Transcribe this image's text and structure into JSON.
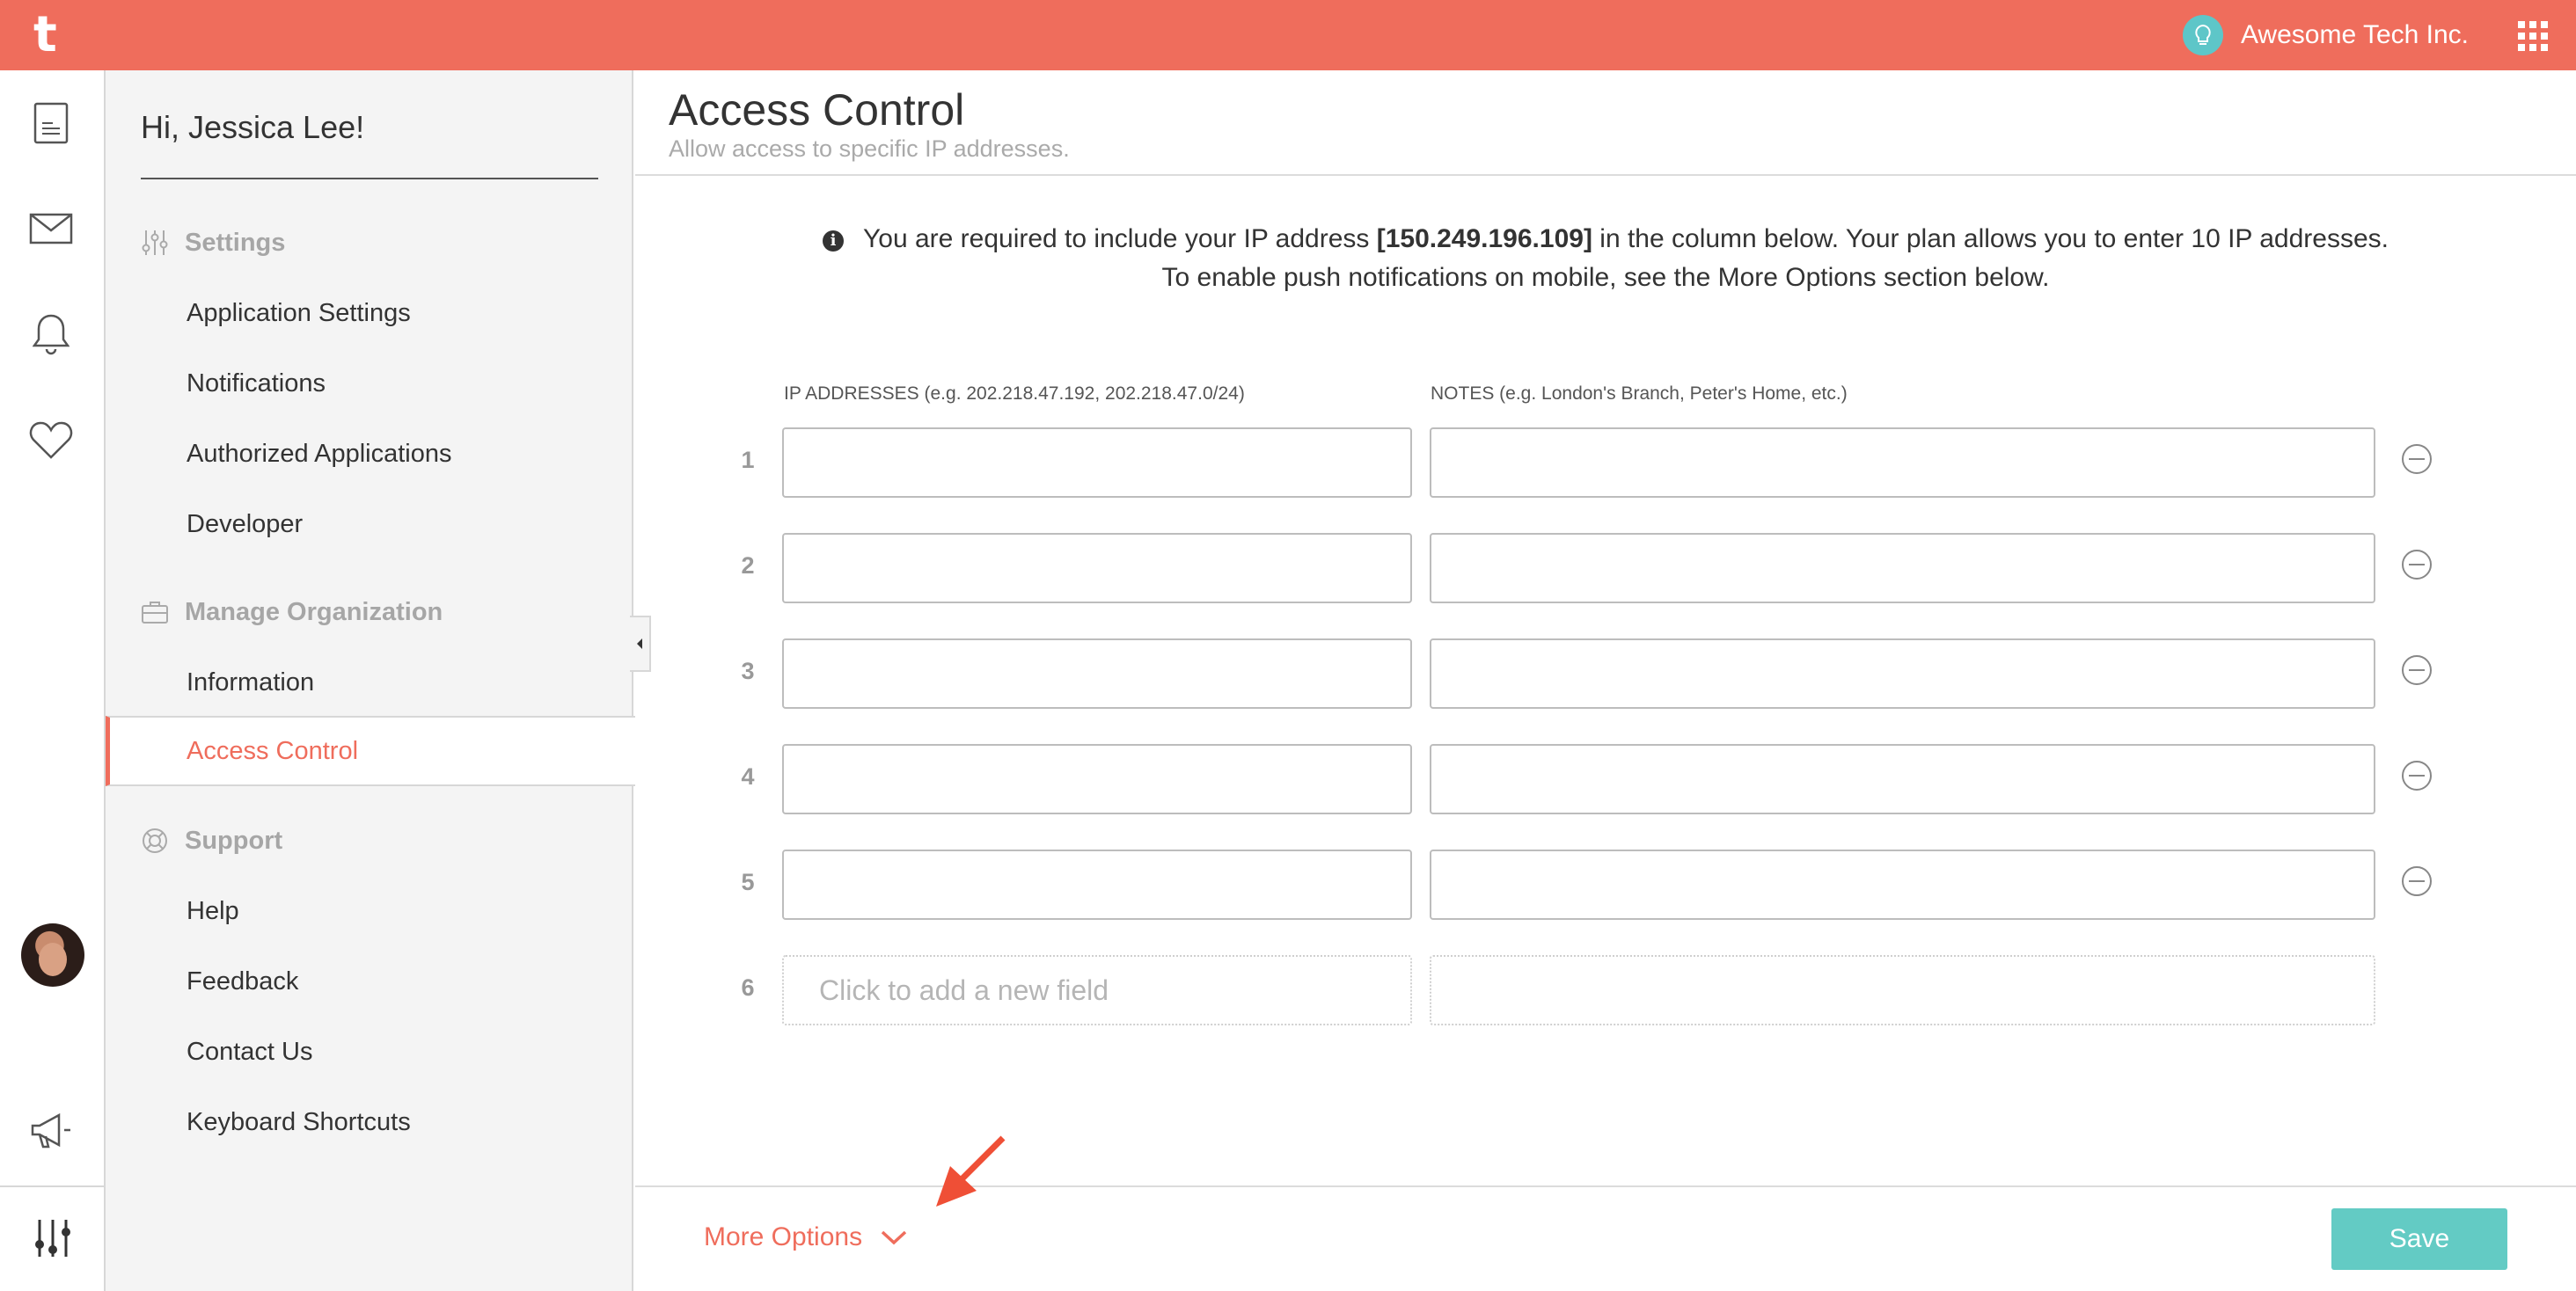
{
  "topbar": {
    "logo": "t",
    "org_name": "Awesome Tech Inc.",
    "color": "#ef6d5c"
  },
  "rail": {
    "icons": [
      "document-icon",
      "mail-icon",
      "bell-icon",
      "heart-icon",
      "avatar",
      "megaphone-icon",
      "sliders-icon"
    ]
  },
  "sidebar": {
    "greeting": "Hi, Jessica Lee!",
    "sections": [
      {
        "title": "Settings",
        "icon": "sliders-icon",
        "items": [
          "Application Settings",
          "Notifications",
          "Authorized Applications",
          "Developer"
        ]
      },
      {
        "title": "Manage Organization",
        "icon": "briefcase-icon",
        "items": [
          "Information",
          "Access Control"
        ]
      },
      {
        "title": "Support",
        "icon": "lifebuoy-icon",
        "items": [
          "Help",
          "Feedback",
          "Contact Us",
          "Keyboard Shortcuts"
        ]
      }
    ],
    "active_item": "Access Control"
  },
  "main": {
    "title": "Access Control",
    "subtitle": "Allow access to specific IP addresses.",
    "info_line1_pre": "You are required to include your IP address",
    "ip_address": "[150.249.196.109]",
    "info_line1_post": "in the column below. Your plan allows you to enter 10 IP addresses.",
    "info_line2": "To enable push notifications on mobile, see the More Options section below.",
    "ip_column_label": "IP ADDRESSES (e.g. 202.218.47.192, 202.218.47.0/24)",
    "notes_column_label": "NOTES (e.g. London's Branch, Peter's Home, etc.)",
    "rows": [
      {
        "num": "1",
        "ip": "",
        "note": ""
      },
      {
        "num": "2",
        "ip": "",
        "note": ""
      },
      {
        "num": "3",
        "ip": "",
        "note": ""
      },
      {
        "num": "4",
        "ip": "",
        "note": ""
      },
      {
        "num": "5",
        "ip": "",
        "note": ""
      }
    ],
    "new_row_num": "6",
    "new_field_placeholder": "Click to add a new field"
  },
  "footer": {
    "more_options": "More Options",
    "save": "Save",
    "save_color": "#63cbc4"
  }
}
